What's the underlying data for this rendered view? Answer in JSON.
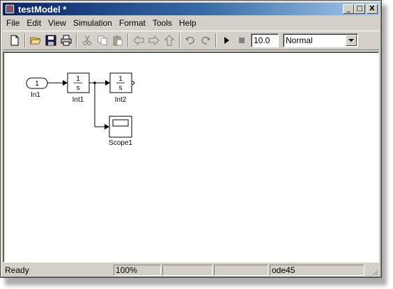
{
  "window": {
    "title": "testModel *"
  },
  "window_buttons": {
    "minimize": "_",
    "maximize": "□",
    "close": "X"
  },
  "menu": [
    "File",
    "Edit",
    "View",
    "Simulation",
    "Format",
    "Tools",
    "Help"
  ],
  "toolbar": {
    "icons": [
      "new-file-icon",
      "open-folder-icon",
      "save-icon",
      "print-icon",
      "cut-icon",
      "copy-icon",
      "paste-icon",
      "back-arrow-icon",
      "forward-arrow-icon",
      "up-arrow-icon",
      "undo-icon",
      "redo-icon",
      "play-icon",
      "stop-icon"
    ],
    "stop_time": "10.0",
    "sim_mode": "Normal"
  },
  "diagram": {
    "blocks": {
      "in1": {
        "port_number": "1",
        "name": "In1"
      },
      "int1": {
        "numerator": "1",
        "denominator": "s",
        "name": "Int1"
      },
      "int2": {
        "numerator": "1",
        "denominator": "s",
        "name": "Int2"
      },
      "scope1": {
        "name": "Scope1"
      }
    }
  },
  "statusbar": {
    "status": "Ready",
    "zoom": "100%",
    "solver": "ode45"
  }
}
